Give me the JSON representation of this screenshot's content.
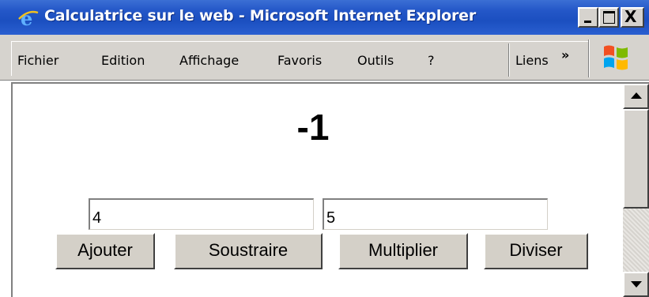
{
  "window": {
    "title": "Calculatrice sur le web - Microsoft Internet Explorer",
    "title_bar_color": "#2457c8",
    "icon": "internet-explorer-icon"
  },
  "window_controls": {
    "minimize": "minimize-icon",
    "maximize": "maximize-icon",
    "close_label": "X"
  },
  "menu": {
    "items": [
      {
        "label": "Fichier"
      },
      {
        "label": "Edition"
      },
      {
        "label": "Affichage"
      },
      {
        "label": "Favoris"
      },
      {
        "label": "Outils"
      },
      {
        "label": "?"
      }
    ],
    "links_label": "Liens",
    "chevron": "»",
    "logo": "windows-logo-icon"
  },
  "calculator": {
    "result": "-1",
    "input_a": "4",
    "input_b": "5",
    "buttons": {
      "add": "Ajouter",
      "subtract": "Soustraire",
      "multiply": "Multiplier",
      "divide": "Diviser"
    }
  }
}
